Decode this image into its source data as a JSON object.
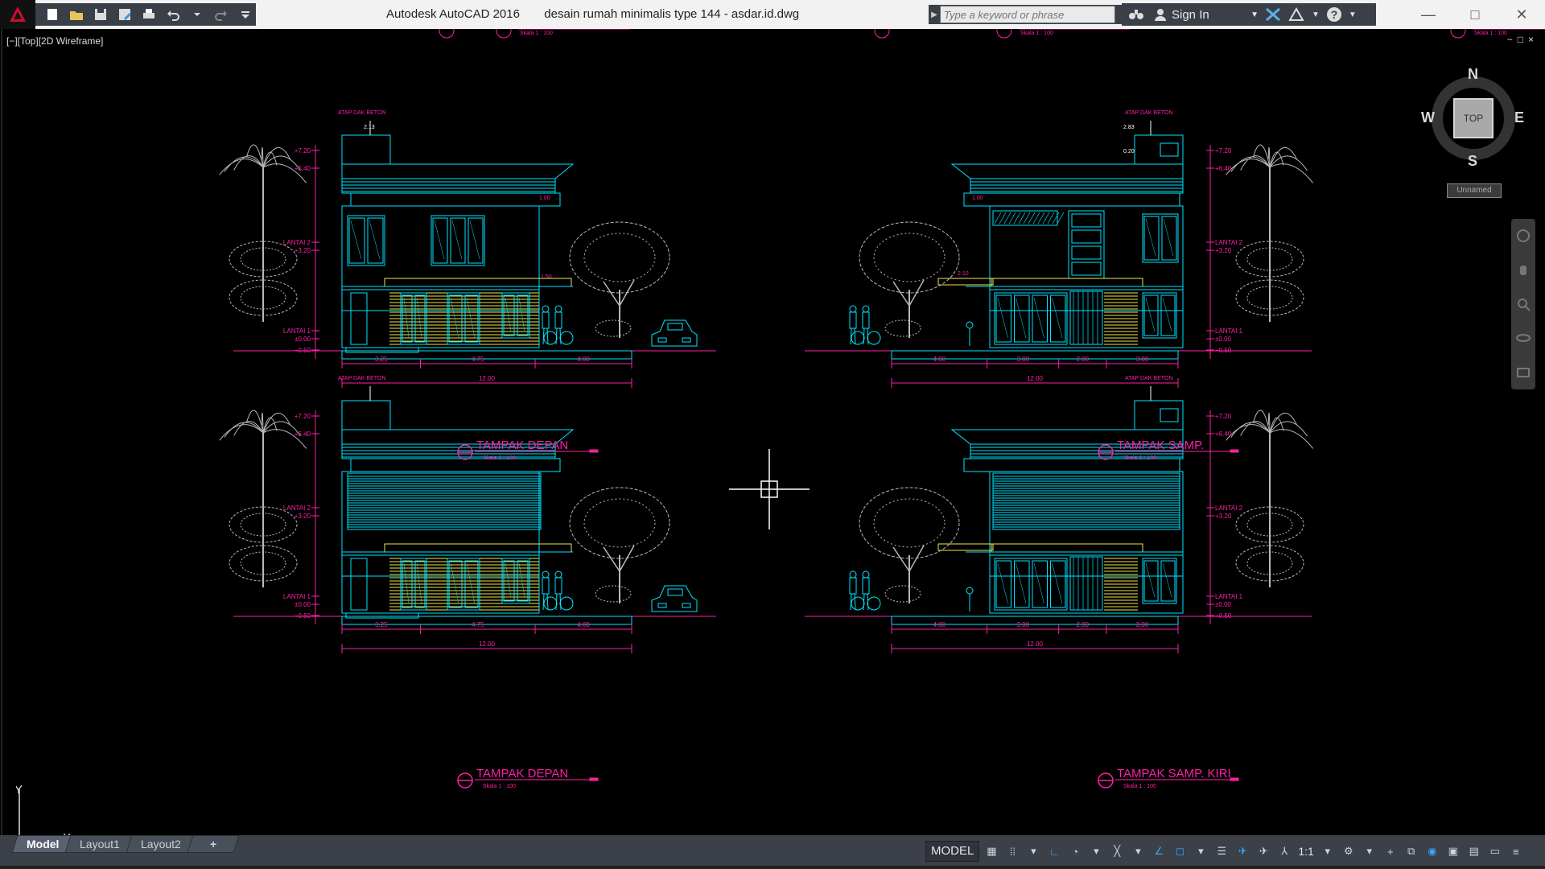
{
  "window": {
    "app_name": "Autodesk AutoCAD 2016",
    "file_name": "desain rumah minimalis type 144 - asdar.id.dwg"
  },
  "search": {
    "placeholder": "Type a keyword or phrase"
  },
  "account": {
    "sign_in": "Sign In"
  },
  "viewport": {
    "label": "[−][Top][2D Wireframe]",
    "controls": [
      "−",
      "□",
      "×"
    ]
  },
  "viewcube": {
    "top": "TOP",
    "north": "N",
    "south": "S",
    "east": "E",
    "west": "W",
    "ucs": "Unnamed"
  },
  "ucs": {
    "x": "X",
    "y": "Y"
  },
  "drawing": {
    "colors": {
      "cyan": "#00e5ff",
      "magenta": "#ff1fa6",
      "yellow": "#f2e64a",
      "gray": "#b9b9b9",
      "white": "#ffffff"
    },
    "top_labels": {
      "scale_1": "Skala  1 : 100",
      "scale_2": "Skala  1 : 100",
      "scale_3": "Skala  1 : 100"
    },
    "elevations": [
      {
        "title": "TAMPAK DEPAN",
        "scale": "Skala  1 : 100",
        "roof": "ATAP DAK BETON",
        "levels": [
          "+7.20",
          "+6.40",
          "LANTAI 2",
          "+3.20",
          "LANTAI 1",
          "±0.00",
          "−0.50"
        ],
        "dims": [
          "3.25",
          "4.75",
          "4.00"
        ],
        "total": "12.00",
        "notes": [
          "2.13",
          "1.00",
          "0.15",
          "0.65",
          "1.50",
          "0.75"
        ]
      },
      {
        "title": "TAMPAK SAMP.",
        "scale": "Skala  1 : 100",
        "roof": "ATAP DAK BETON",
        "levels": [
          "+7.20",
          "+6.40",
          "LANTAI 2",
          "+3.20",
          "LANTAI 1",
          "±0.00",
          "−0.50"
        ],
        "dims": [
          "4.00",
          "3.00",
          "2.00",
          "3.00"
        ],
        "total": "12.00",
        "notes": [
          "2.83",
          "0.20",
          "1.00",
          "0.65",
          "2.10"
        ]
      },
      {
        "title": "TAMPAK DEPAN",
        "scale": "Skala  1 : 100",
        "roof": "ATAP DAK BETON",
        "levels": [
          "+7.20",
          "+6.40",
          "LANTAI 2",
          "+3.20",
          "LANTAI 1",
          "±0.00",
          "−0.50"
        ],
        "dims": [
          "3.25",
          "4.75",
          "4.00"
        ],
        "total": "12.00"
      },
      {
        "title": "TAMPAK SAMP. KIRI",
        "scale": "Skala  1 : 100",
        "roof": "ATAP DAK BETON",
        "levels": [
          "+7.20",
          "+6.40",
          "LANTAI 2",
          "+3.20",
          "LANTAI 1",
          "±0.00",
          "−0.50"
        ],
        "dims": [
          "4.00",
          "3.00",
          "2.00",
          "3.00"
        ],
        "total": "12.00"
      }
    ]
  },
  "layouts": {
    "tabs": [
      "Model",
      "Layout1",
      "Layout2"
    ],
    "add": "+"
  },
  "status": {
    "model": "MODEL",
    "scale": "1:1"
  }
}
